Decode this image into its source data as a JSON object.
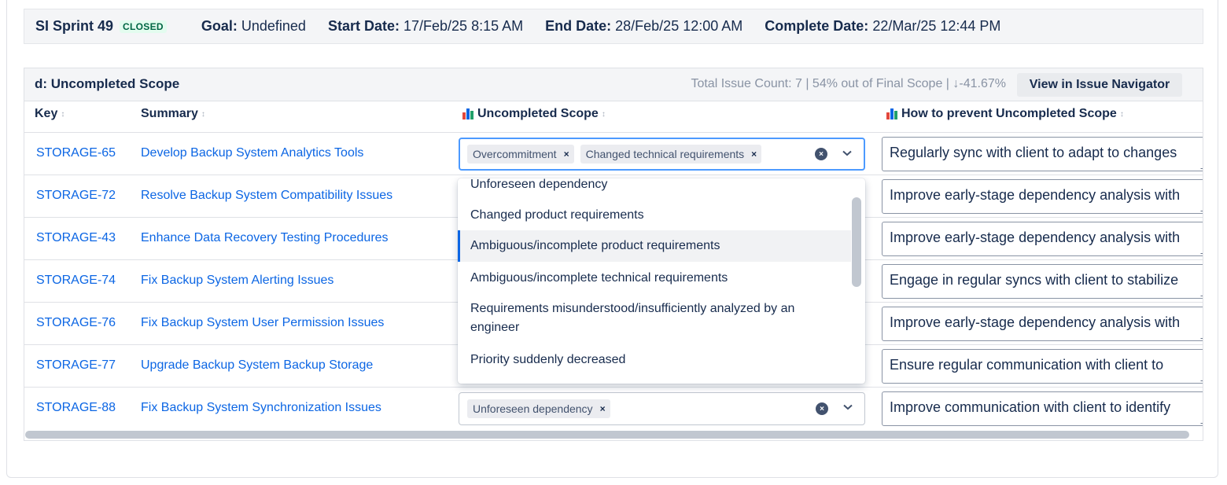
{
  "sprint": {
    "name": "SI Sprint 49",
    "status": "CLOSED",
    "goal_label": "Goal:",
    "goal": "Undefined",
    "start_label": "Start Date:",
    "start": "17/Feb/25 8:15 AM",
    "end_label": "End Date:",
    "end": "28/Feb/25 12:00 AM",
    "complete_label": "Complete Date:",
    "complete": "22/Mar/25 12:44 PM"
  },
  "scope": {
    "title": "d: Uncompleted Scope",
    "stats": "Total Issue Count: 7 | 54% out of Final Scope | ↓-41.67%",
    "nav_button": "View in Issue Navigator"
  },
  "columns": {
    "key": "Key",
    "summary": "Summary",
    "uncompleted": "Uncompleted Scope",
    "prevent": "How to prevent Uncompleted Scope",
    "sort_icon": "↕",
    "chart_colors": [
      "#e2483d",
      "#0c66e4",
      "#22a06b"
    ]
  },
  "rows": [
    {
      "key": "STORAGE-65",
      "summary": "Develop Backup System Analytics Tools",
      "tags": [
        "Overcommitment",
        "Changed technical requirements"
      ],
      "prevent": "Regularly sync with client to adapt to changes"
    },
    {
      "key": "STORAGE-72",
      "summary": "Resolve Backup System Compatibility Issues",
      "tags": [],
      "prevent": "Improve early-stage dependency analysis with"
    },
    {
      "key": "STORAGE-43",
      "summary": "Enhance Data Recovery Testing Procedures",
      "tags": [],
      "prevent": "Improve early-stage dependency analysis with"
    },
    {
      "key": "STORAGE-74",
      "summary": "Fix Backup System Alerting Issues",
      "tags": [],
      "prevent": "Engage in regular syncs with client to stabilize"
    },
    {
      "key": "STORAGE-76",
      "summary": "Fix Backup System User Permission Issues",
      "tags": [],
      "prevent": "Improve early-stage dependency analysis with"
    },
    {
      "key": "STORAGE-77",
      "summary": "Upgrade Backup System Backup Storage",
      "tags": [],
      "prevent": "Ensure regular communication with client to"
    },
    {
      "key": "STORAGE-88",
      "summary": "Fix Backup System Synchronization Issues",
      "tags": [
        "Unforeseen dependency"
      ],
      "prevent": "Improve communication with client to identify"
    }
  ],
  "dropdown": {
    "options": [
      "Unforeseen dependency",
      "Changed product requirements",
      "Ambiguous/incomplete product requirements",
      "Ambiguous/incomplete technical requirements",
      "Requirements misunderstood/insufficiently analyzed by an engineer",
      "Priority suddenly decreased"
    ],
    "highlighted": "Ambiguous/incomplete product requirements"
  },
  "icons": {
    "chip_remove": "×",
    "clear": "×",
    "chevron": "⌄"
  }
}
